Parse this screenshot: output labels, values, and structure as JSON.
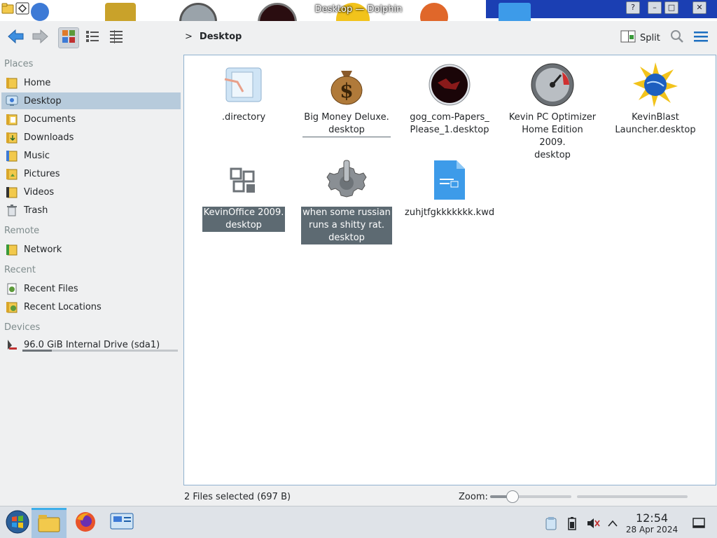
{
  "window": {
    "title": "Desktop — Dolphin",
    "buttons": {
      "help": "?",
      "minimize": "–",
      "maximize": "□",
      "close": "✕"
    }
  },
  "toolbar": {
    "breadcrumb_separator": ">",
    "breadcrumb": "Desktop",
    "split_label": "Split"
  },
  "sidebar": {
    "sections": {
      "places": "Places",
      "remote": "Remote",
      "recent": "Recent",
      "devices": "Devices"
    },
    "places": [
      {
        "label": "Home",
        "icon": "home-folder-icon"
      },
      {
        "label": "Desktop",
        "icon": "desktop-icon",
        "selected": true
      },
      {
        "label": "Documents",
        "icon": "documents-folder-icon"
      },
      {
        "label": "Downloads",
        "icon": "downloads-folder-icon"
      },
      {
        "label": "Music",
        "icon": "music-folder-icon"
      },
      {
        "label": "Pictures",
        "icon": "pictures-folder-icon"
      },
      {
        "label": "Videos",
        "icon": "videos-folder-icon"
      },
      {
        "label": "Trash",
        "icon": "trash-icon"
      }
    ],
    "remote": [
      {
        "label": "Network",
        "icon": "network-folder-icon"
      }
    ],
    "recent": [
      {
        "label": "Recent Files",
        "icon": "recent-files-icon"
      },
      {
        "label": "Recent Locations",
        "icon": "recent-locations-icon"
      }
    ],
    "devices": [
      {
        "label": "96.0 GiB Internal Drive (sda1)",
        "icon": "hard-drive-icon",
        "usage_fraction": 0.19
      }
    ]
  },
  "files": [
    {
      "name": ".directory",
      "icon": "config-file-icon",
      "state": "dim"
    },
    {
      "name": "Big Money Deluxe.\ndesktop",
      "icon": "money-bag-icon",
      "state": "hover"
    },
    {
      "name": "gog_com-Papers_\nPlease_1.desktop",
      "icon": "papers-please-icon",
      "state": "normal"
    },
    {
      "name": "Kevin PC Optimizer\nHome Edition 2009.\ndesktop",
      "icon": "speedometer-icon",
      "state": "normal"
    },
    {
      "name": "KevinBlast\nLauncher.desktop",
      "icon": "globe-sun-icon",
      "state": "normal"
    },
    {
      "name": "KevinOffice 2009.\ndesktop",
      "icon": "office-suite-icon",
      "state": "selected"
    },
    {
      "name": "when some russian\nruns a shitty rat.\ndesktop",
      "icon": "gear-icon",
      "state": "selected"
    },
    {
      "name": "zuhjtfgkkkkkkk.kwd",
      "icon": "document-file-icon",
      "state": "normal"
    }
  ],
  "statusbar": {
    "selection_text": "2 Files selected (697 B)",
    "zoom_label": "Zoom:",
    "zoom_fraction": 0.28
  },
  "taskbar": {
    "apps": [
      "start-menu-icon",
      "file-manager-icon",
      "firefox-icon",
      "system-settings-icon"
    ],
    "tray": [
      "clipboard-icon",
      "battery-icon",
      "volume-muted-icon",
      "tray-expand-icon",
      "show-desktop-icon"
    ],
    "clock_time": "12:54",
    "clock_date": "28 Apr 2024"
  },
  "colors": {
    "selection": "#5d6a72",
    "sidebar_selected": "#b7cbdc",
    "accent": "#3daee9",
    "titlebar_blue": "#1b3fb3"
  }
}
